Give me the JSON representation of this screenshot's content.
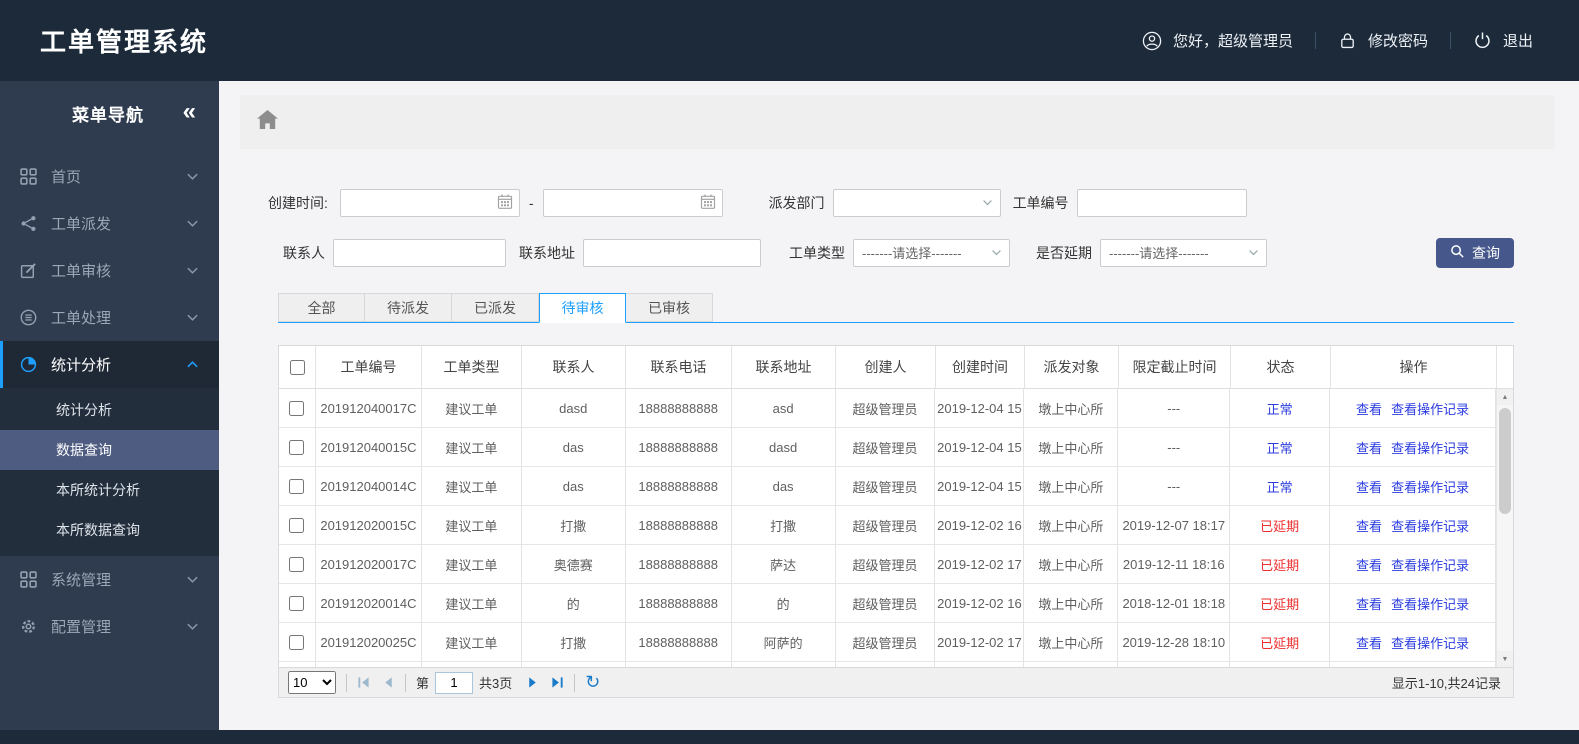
{
  "app": {
    "title": "工单管理系统"
  },
  "header": {
    "greeting": "您好，超级管理员",
    "change_password": "修改密码",
    "logout": "退出"
  },
  "sidebar": {
    "title": "菜单导航",
    "collapse": "«",
    "items": [
      {
        "label": "首页",
        "icon": "grid-icon"
      },
      {
        "label": "工单派发",
        "icon": "share-icon"
      },
      {
        "label": "工单审核",
        "icon": "edit-icon"
      },
      {
        "label": "工单处理",
        "icon": "process-icon"
      },
      {
        "label": "统计分析",
        "icon": "pie-icon",
        "active": true,
        "expanded": true
      },
      {
        "label": "系统管理",
        "icon": "grid-icon"
      },
      {
        "label": "配置管理",
        "icon": "gear-icon"
      }
    ],
    "submenu": [
      {
        "label": "统计分析",
        "selected": false
      },
      {
        "label": "数据查询",
        "selected": true
      },
      {
        "label": "本所统计分析",
        "selected": false
      },
      {
        "label": "本所数据查询",
        "selected": false
      }
    ]
  },
  "filters": {
    "created_label": "创建时间:",
    "range_separator": "-",
    "dept_label": "派发部门",
    "order_no_label": "工单编号",
    "contact_label": "联系人",
    "address_label": "联系地址",
    "type_label": "工单类型",
    "type_value": "-------请选择-------",
    "delay_label": "是否延期",
    "delay_value": "-------请选择-------",
    "search_label": "查询"
  },
  "tabs": [
    {
      "label": "全部",
      "active": false
    },
    {
      "label": "待派发",
      "active": false
    },
    {
      "label": "已派发",
      "active": false
    },
    {
      "label": "待审核",
      "active": true
    },
    {
      "label": "已审核",
      "active": false
    }
  ],
  "table": {
    "columns": [
      "工单编号",
      "工单类型",
      "联系人",
      "联系电话",
      "联系地址",
      "创建人",
      "创建时间",
      "派发对象",
      "限定截止时间",
      "状态",
      "操作"
    ],
    "action_view": "查看",
    "action_log": "查看操作记录",
    "status_colors": {
      "normal": "#2b3cdf",
      "delayed": "#ee2f2f"
    },
    "rows": [
      {
        "order_no": "201912040017C",
        "type": "建议工单",
        "contact": "dasd",
        "phone": "18888888888",
        "address": "asd",
        "creator": "超级管理员",
        "created": "2019-12-04 15",
        "target": "墩上中心所",
        "deadline": "---",
        "status": "正常",
        "state": "normal"
      },
      {
        "order_no": "201912040015C",
        "type": "建议工单",
        "contact": "das",
        "phone": "18888888888",
        "address": "dasd",
        "creator": "超级管理员",
        "created": "2019-12-04 15",
        "target": "墩上中心所",
        "deadline": "---",
        "status": "正常",
        "state": "normal"
      },
      {
        "order_no": "201912040014C",
        "type": "建议工单",
        "contact": "das",
        "phone": "18888888888",
        "address": "das",
        "creator": "超级管理员",
        "created": "2019-12-04 15",
        "target": "墩上中心所",
        "deadline": "---",
        "status": "正常",
        "state": "normal"
      },
      {
        "order_no": "201912020015C",
        "type": "建议工单",
        "contact": "打撒",
        "phone": "18888888888",
        "address": "打撒",
        "creator": "超级管理员",
        "created": "2019-12-02 16",
        "target": "墩上中心所",
        "deadline": "2019-12-07 18:17",
        "status": "已延期",
        "state": "delayed"
      },
      {
        "order_no": "201912020017C",
        "type": "建议工单",
        "contact": "奥德赛",
        "phone": "18888888888",
        "address": "萨达",
        "creator": "超级管理员",
        "created": "2019-12-02 17",
        "target": "墩上中心所",
        "deadline": "2019-12-11 18:16",
        "status": "已延期",
        "state": "delayed"
      },
      {
        "order_no": "201912020014C",
        "type": "建议工单",
        "contact": "的",
        "phone": "18888888888",
        "address": "的",
        "creator": "超级管理员",
        "created": "2019-12-02 16",
        "target": "墩上中心所",
        "deadline": "2018-12-01 18:18",
        "status": "已延期",
        "state": "delayed"
      },
      {
        "order_no": "201912020025C",
        "type": "建议工单",
        "contact": "打撒",
        "phone": "18888888888",
        "address": "阿萨的",
        "creator": "超级管理员",
        "created": "2019-12-02 17",
        "target": "墩上中心所",
        "deadline": "2019-12-28 18:10",
        "status": "已延期",
        "state": "delayed"
      },
      {
        "order_no": "",
        "type": "",
        "contact": "",
        "phone": "",
        "address": "",
        "creator": "",
        "created": "",
        "target": "",
        "deadline": "",
        "status": "",
        "state": "partial"
      }
    ]
  },
  "pagination": {
    "page_size": "10",
    "page_prefix": "第",
    "page_value": "1",
    "page_total": "共3页",
    "summary": "显示1-10,共24记录"
  }
}
